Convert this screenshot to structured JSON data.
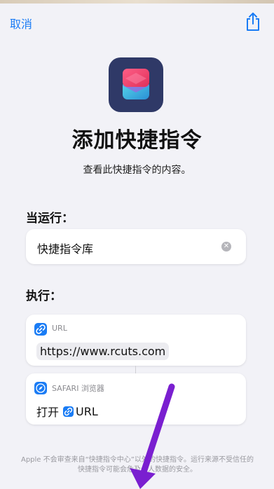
{
  "header": {
    "cancel_label": "取消",
    "share_icon": "share-icon"
  },
  "app": {
    "icon": "shortcuts-app-icon",
    "title": "添加快捷指令",
    "subtitle": "查看此快捷指令的内容。"
  },
  "when_section": {
    "label": "当运行：",
    "value": "快捷指令库",
    "clear_icon": "clear-icon"
  },
  "execute_section": {
    "label": "执行：",
    "actions": [
      {
        "icon": "link-icon",
        "header": "URL",
        "value": "https://www.rcuts.com"
      },
      {
        "icon": "safari-compass-icon",
        "header": "SAFARI 浏览器",
        "verb": "打开",
        "param": "URL"
      }
    ]
  },
  "footer": {
    "text": "Apple 不会审查来自“快捷指令中心”以外的快捷指令。运行来源不受信任的快捷指令可能会危及个人数据的安全。"
  },
  "colors": {
    "accent": "#1a7cf5",
    "arrow": "#7a1fd0",
    "background": "#f2f2f7"
  }
}
